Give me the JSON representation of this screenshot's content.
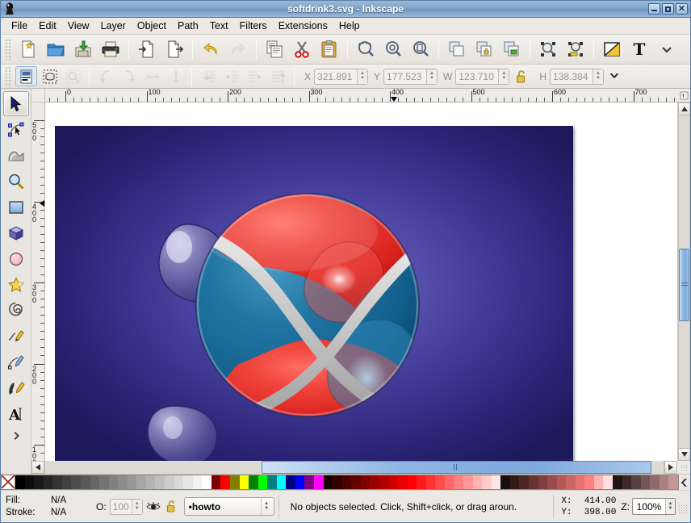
{
  "window": {
    "title": "softdrink3.svg - Inkscape",
    "app_icon": "inkscape-logo-icon",
    "buttons": {
      "minimize": "minimize-icon",
      "maximize": "maximize-icon",
      "close": "close-icon"
    }
  },
  "menu": {
    "items": [
      "File",
      "Edit",
      "View",
      "Layer",
      "Object",
      "Path",
      "Text",
      "Filters",
      "Extensions",
      "Help"
    ]
  },
  "toolbar_commands": {
    "groups": [
      {
        "items": [
          {
            "name": "new-document",
            "icon": "new-document-icon",
            "enabled": true
          },
          {
            "name": "open-document",
            "icon": "open-folder-icon",
            "enabled": true
          },
          {
            "name": "save-document",
            "icon": "save-disk-icon",
            "enabled": true
          },
          {
            "name": "print-document",
            "icon": "printer-icon",
            "enabled": true
          }
        ]
      },
      {
        "items": [
          {
            "name": "import",
            "icon": "import-arrow-icon",
            "enabled": true
          },
          {
            "name": "export",
            "icon": "export-arrow-icon",
            "enabled": true
          }
        ]
      },
      {
        "items": [
          {
            "name": "undo",
            "icon": "undo-arrow-icon",
            "enabled": true
          },
          {
            "name": "redo",
            "icon": "redo-arrow-icon",
            "enabled": false
          }
        ]
      },
      {
        "items": [
          {
            "name": "copy",
            "icon": "copy-pages-icon",
            "enabled": true
          },
          {
            "name": "cut",
            "icon": "scissors-icon",
            "enabled": true
          },
          {
            "name": "paste",
            "icon": "clipboard-icon",
            "enabled": true
          }
        ]
      },
      {
        "items": [
          {
            "name": "zoom-selection",
            "icon": "zoom-selection-icon",
            "enabled": true
          },
          {
            "name": "zoom-drawing",
            "icon": "zoom-drawing-icon",
            "enabled": true
          },
          {
            "name": "zoom-page",
            "icon": "zoom-page-icon",
            "enabled": true
          }
        ]
      },
      {
        "items": [
          {
            "name": "duplicate",
            "icon": "duplicate-icon",
            "enabled": true
          },
          {
            "name": "group",
            "icon": "group-lock-icon",
            "enabled": true
          },
          {
            "name": "ungroup",
            "icon": "ungroup-icon",
            "enabled": true
          }
        ]
      },
      {
        "items": [
          {
            "name": "raise-to-top",
            "icon": "object-raise-icon",
            "enabled": true
          },
          {
            "name": "lower-to-bottom",
            "icon": "object-lower-icon",
            "enabled": true
          }
        ]
      },
      {
        "items": [
          {
            "name": "fill-and-stroke",
            "icon": "fill-stroke-dialog-icon",
            "enabled": true
          },
          {
            "name": "text-and-font",
            "icon": "text-tool-icon",
            "enabled": true
          }
        ]
      }
    ],
    "overflow": "chevron-down-icon"
  },
  "tool_controls": {
    "buttons": [
      {
        "name": "select-all",
        "icon": "select-all-icon",
        "enabled": true,
        "active": true
      },
      {
        "name": "select-all-in-all-layers",
        "icon": "select-all-layers-icon",
        "enabled": true,
        "active": false
      },
      {
        "name": "deselect",
        "icon": "deselect-icon",
        "enabled": false,
        "active": false
      },
      {
        "name": "rotate-ccw",
        "icon": "rotate-ccw-icon",
        "enabled": false,
        "active": false
      },
      {
        "name": "rotate-cw",
        "icon": "rotate-cw-icon",
        "enabled": false,
        "active": false
      },
      {
        "name": "flip-horizontal",
        "icon": "flip-horizontal-icon",
        "enabled": false,
        "active": false
      },
      {
        "name": "flip-vertical",
        "icon": "flip-vertical-icon",
        "enabled": false,
        "active": false
      },
      {
        "name": "lower-to-bottom",
        "icon": "lower-bottom-icon",
        "enabled": false,
        "active": false
      },
      {
        "name": "lower-one-step",
        "icon": "lower-step-icon",
        "enabled": false,
        "active": false
      },
      {
        "name": "raise-one-step",
        "icon": "raise-step-icon",
        "enabled": false,
        "active": false
      },
      {
        "name": "raise-to-top",
        "icon": "raise-top-icon",
        "enabled": false,
        "active": false
      }
    ],
    "fields": [
      {
        "label": "X",
        "value": "321.891"
      },
      {
        "label": "Y",
        "value": "177.523"
      },
      {
        "label": "W",
        "value": "123.710"
      }
    ],
    "lock_icon": "lock-open-icon",
    "height_field": {
      "label": "H",
      "value": "138.384"
    },
    "overflow": "chevron-down-icon"
  },
  "toolbox": {
    "tools": [
      {
        "name": "selector-tool",
        "icon": "arrow-pointer-icon",
        "selected": true
      },
      {
        "name": "node-editor-tool",
        "icon": "node-edit-icon",
        "selected": false
      },
      {
        "name": "tweak-tool",
        "icon": "tweak-wave-icon",
        "selected": false
      },
      {
        "name": "zoom-tool",
        "icon": "magnifier-icon",
        "selected": false
      },
      {
        "name": "rectangle-tool",
        "icon": "rectangle-icon",
        "selected": false
      },
      {
        "name": "box3d-tool",
        "icon": "cube-3d-icon",
        "selected": false
      },
      {
        "name": "ellipse-tool",
        "icon": "ellipse-icon",
        "selected": false
      },
      {
        "name": "star-tool",
        "icon": "star-icon",
        "selected": false
      },
      {
        "name": "spiral-tool",
        "icon": "spiral-icon",
        "selected": false
      },
      {
        "name": "pencil-tool",
        "icon": "pencil-icon",
        "selected": false
      },
      {
        "name": "bezier-pen-tool",
        "icon": "bezier-pen-icon",
        "selected": false
      },
      {
        "name": "calligraphy-tool",
        "icon": "calligraphy-pen-icon",
        "selected": false
      },
      {
        "name": "text-tool",
        "icon": "text-a-icon",
        "selected": false
      }
    ],
    "more": "more-tools-chevron-icon"
  },
  "rulers": {
    "horizontal_labels": [
      "0",
      "100",
      "200",
      "300",
      "400",
      "500",
      "600",
      "700"
    ],
    "vertical_labels": [
      "500",
      "400",
      "300",
      "200",
      "100"
    ],
    "units_button": "ruler-units-icon"
  },
  "canvas": {
    "artwork_name": "softdrink-ball-artwork",
    "background_colors": {
      "outer": "#2a1f6e",
      "inner": "#5b55ae"
    },
    "ball_colors": {
      "red": "#e02a28",
      "blue": "#1d6b99",
      "stripe": "#c9c9c9"
    },
    "blob_color": "#5a58a0"
  },
  "scrollbars": {
    "vertical": {
      "up": "scroll-up-icon",
      "down": "scroll-down-icon"
    },
    "horizontal": {
      "left": "scroll-left-icon",
      "right": "scroll-right-icon"
    }
  },
  "palette": {
    "no_color_swatch": "no-color-x-icon",
    "colors": [
      "#000000",
      "#0d0d0d",
      "#1a1a1a",
      "#262626",
      "#333333",
      "#404040",
      "#4d4d4d",
      "#595959",
      "#666666",
      "#737373",
      "#808080",
      "#8c8c8c",
      "#999999",
      "#a6a6a6",
      "#b3b3b3",
      "#bfbfbf",
      "#cccccc",
      "#d9d9d9",
      "#e6e6e6",
      "#f2f2f2",
      "#ffffff",
      "#800000",
      "#ff0000",
      "#808000",
      "#ffff00",
      "#008000",
      "#00ff00",
      "#008080",
      "#00ffff",
      "#000080",
      "#0000ff",
      "#800080",
      "#ff00ff",
      "#1a0000",
      "#330000",
      "#4d0000",
      "#660000",
      "#800000",
      "#990000",
      "#b30000",
      "#cc0000",
      "#e60000",
      "#ff0000",
      "#ff1a1a",
      "#ff3333",
      "#ff4d4d",
      "#ff6666",
      "#ff8080",
      "#ff9999",
      "#ffb3b3",
      "#ffcccc",
      "#ffe6e6",
      "#1a0d0d",
      "#331a1a",
      "#4d2626",
      "#663333",
      "#803f3f",
      "#994c4c",
      "#b35959",
      "#cc6666",
      "#e67373",
      "#ff8080",
      "#ffb3b3",
      "#ffe0e0",
      "#1f1515",
      "#3b2b2b",
      "#574040",
      "#735656",
      "#8f6b6b",
      "#ab8181",
      "#c79696"
    ],
    "scroll_icon": "palette-scroll-left-icon"
  },
  "statusbar": {
    "fill_label": "Fill:",
    "fill_value": "N/A",
    "stroke_label": "Stroke:",
    "stroke_value": "N/A",
    "opacity_label": "O:",
    "opacity_value": "100",
    "visibility_icon": "eye-icon",
    "lock_icon": "lock-open-icon",
    "layer_name": "•howto",
    "message": "No objects selected. Click, Shift+click, or drag aroun.",
    "pointer_x_label": "X:",
    "pointer_x": "414.00",
    "pointer_y_label": "Y:",
    "pointer_y": "398.00",
    "zoom_label": "Z:",
    "zoom_value": "100%"
  }
}
